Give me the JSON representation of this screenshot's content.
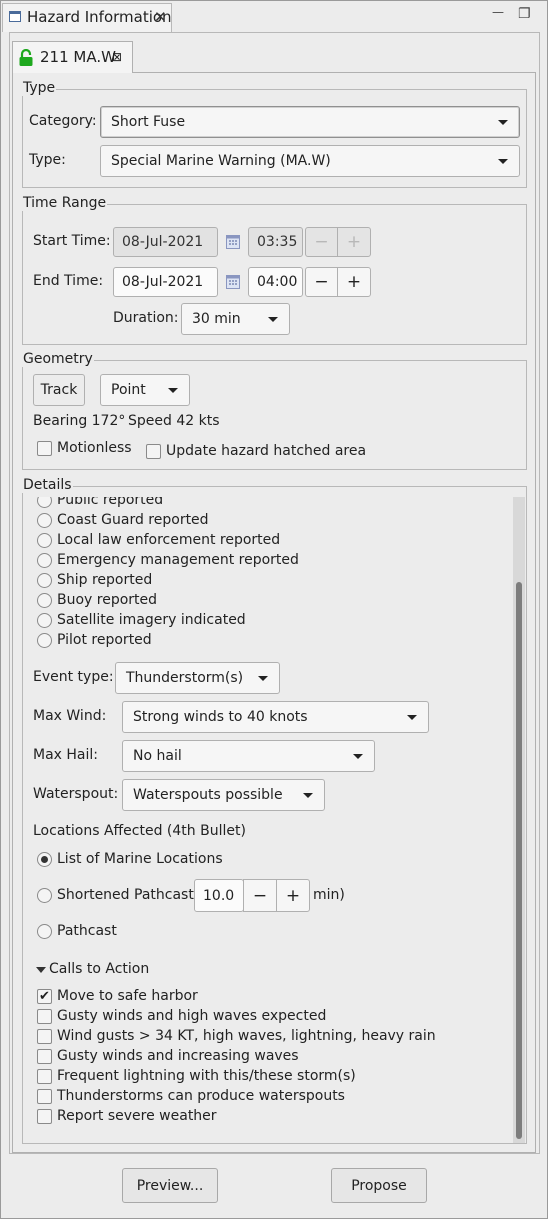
{
  "view": {
    "title": "Hazard Information",
    "close": "✕",
    "minimize": "—",
    "maximize": "❐"
  },
  "tab": {
    "label": "211 MA.W",
    "close": "⊠",
    "lock_color": "#1ea81e"
  },
  "type_group": {
    "title": "Type",
    "category_label": "Category:",
    "category_value": "Short Fuse",
    "type_label": "Type:",
    "type_value": "Special Marine Warning (MA.W)"
  },
  "time_range": {
    "title": "Time Range",
    "start_label": "Start Time:",
    "start_date": "08-Jul-2021",
    "start_time": "03:35",
    "end_label": "End Time:",
    "end_date": "08-Jul-2021",
    "end_time": "04:00",
    "duration_label": "Duration:",
    "duration_value": "30 min",
    "minus": "−",
    "plus": "+"
  },
  "geometry": {
    "title": "Geometry",
    "track_button": "Track",
    "mode_value": "Point",
    "bearing": "Bearing 172°",
    "speed": "Speed 42 kts",
    "motionless": "Motionless",
    "update_hatched": "Update hazard hatched area"
  },
  "details": {
    "title": "Details",
    "source_options": [
      "Public reported",
      "Coast Guard reported",
      "Local law enforcement reported",
      "Emergency management reported",
      "Ship reported",
      "Buoy reported",
      "Satellite imagery indicated",
      "Pilot reported"
    ],
    "event_type_label": "Event type:",
    "event_type_value": "Thunderstorm(s)",
    "max_wind_label": "Max Wind:",
    "max_wind_value": "Strong winds to 40 knots",
    "max_hail_label": "Max Hail:",
    "max_hail_value": "No hail",
    "waterspout_label": "Waterspout:",
    "waterspout_value": "Waterspouts possible",
    "locations_title": "Locations Affected (4th Bullet)",
    "loc_list": "List of Marine Locations",
    "loc_short_prefix": "Shortened Pathcast (",
    "loc_short_value": "10.0",
    "loc_short_suffix": "min)",
    "loc_pathcast": "Pathcast",
    "cta_title": "Calls to Action",
    "cta_items": [
      {
        "label": "Move to safe harbor",
        "checked": true
      },
      {
        "label": "Gusty winds and high waves expected",
        "checked": false
      },
      {
        "label": "Wind gusts > 34 KT, high waves, lightning, heavy rain",
        "checked": false
      },
      {
        "label": "Gusty winds and increasing waves",
        "checked": false
      },
      {
        "label": "Frequent lightning with this/these storm(s)",
        "checked": false
      },
      {
        "label": "Thunderstorms can produce waterspouts",
        "checked": false
      },
      {
        "label": "Report severe weather",
        "checked": false
      }
    ]
  },
  "footer": {
    "preview": "Preview...",
    "propose": "Propose"
  }
}
